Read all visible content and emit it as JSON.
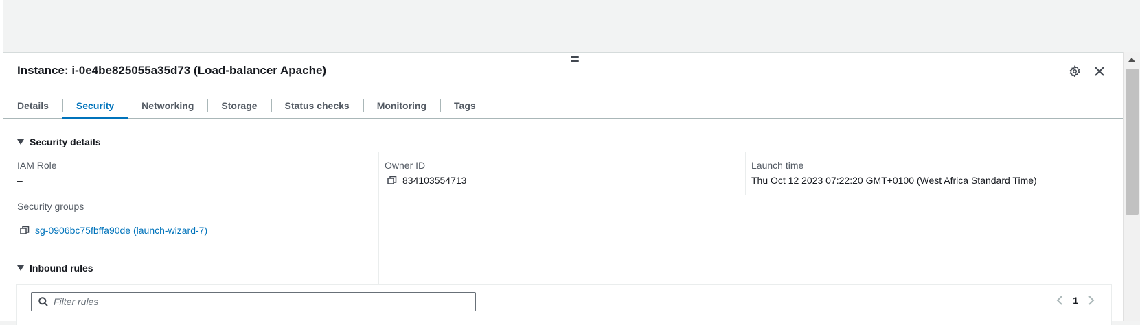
{
  "panel": {
    "title": "Instance: i-0e4be825055a35d73 (Load-balancer Apache)"
  },
  "header_icons": {
    "settings": "gear-icon",
    "close": "close-icon"
  },
  "tabs": [
    {
      "label": "Details",
      "active": false
    },
    {
      "label": "Security",
      "active": true
    },
    {
      "label": "Networking",
      "active": false
    },
    {
      "label": "Storage",
      "active": false
    },
    {
      "label": "Status checks",
      "active": false
    },
    {
      "label": "Monitoring",
      "active": false
    },
    {
      "label": "Tags",
      "active": false
    }
  ],
  "security_details": {
    "heading": "Security details",
    "iam_role_label": "IAM Role",
    "iam_role_value": "–",
    "owner_id_label": "Owner ID",
    "owner_id_value": "834103554713",
    "launch_time_label": "Launch time",
    "launch_time_value": "Thu Oct 12 2023 07:22:20 GMT+0100 (West Africa Standard Time)",
    "security_groups_label": "Security groups",
    "security_group_link": "sg-0906bc75fbffa90de (launch-wizard-7)"
  },
  "inbound_rules": {
    "heading": "Inbound rules",
    "filter_placeholder": "Filter rules",
    "page": "1"
  },
  "colors": {
    "accent": "#0073bb",
    "text": "#16191f",
    "muted": "#545b64"
  }
}
